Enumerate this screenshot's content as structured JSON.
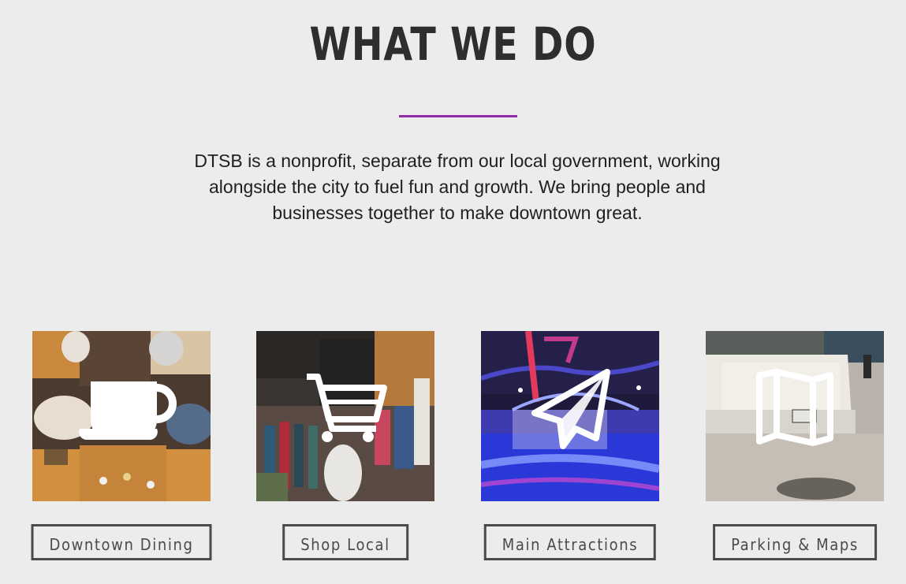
{
  "section": {
    "title": "WHAT WE DO",
    "intro": "DTSB is a nonprofit, separate from our local government, working alongside the city to fuel fun and growth. We bring people and businesses together to make downtown great.",
    "accent_color": "#8e2fa6"
  },
  "cards": [
    {
      "icon": "coffee-cup-icon",
      "button_label": "Downtown Dining"
    },
    {
      "icon": "shopping-cart-icon",
      "button_label": "Shop Local"
    },
    {
      "icon": "paper-plane-icon",
      "button_label": "Main Attractions"
    },
    {
      "icon": "folded-map-icon",
      "button_label": "Parking & Maps"
    }
  ]
}
